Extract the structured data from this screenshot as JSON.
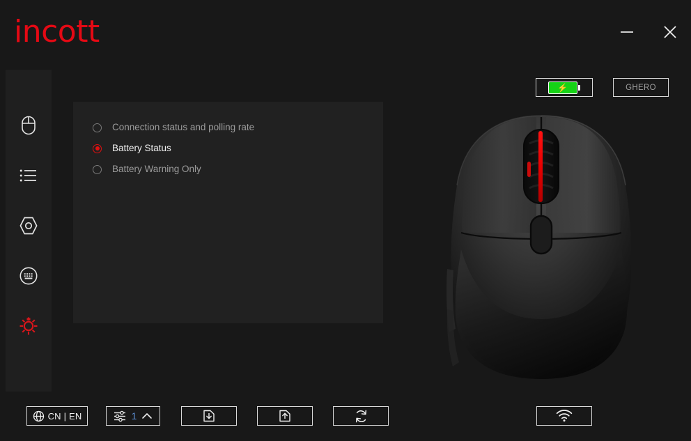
{
  "window": {
    "brand_logo_text": "incott",
    "accent_color": "#e50914",
    "background_color": "#181818",
    "panel_color": "#212121",
    "controls": [
      {
        "name": "minimize",
        "glyph": "minimize-icon"
      },
      {
        "name": "close",
        "glyph": "close-icon"
      }
    ]
  },
  "sidebar": {
    "items": [
      {
        "icon": "mouse-icon",
        "name": "mouse",
        "active": false
      },
      {
        "icon": "list-icon",
        "name": "macro-list",
        "active": false
      },
      {
        "icon": "hex-nut-icon",
        "name": "performance",
        "active": false
      },
      {
        "icon": "keyboard-circle-icon",
        "name": "keyboard",
        "active": false
      },
      {
        "icon": "gear-icon",
        "name": "settings",
        "active": true
      }
    ],
    "active_color": "#d6161b",
    "inactive_color": "#e4e4e4"
  },
  "main": {
    "options": [
      {
        "label": "Connection status and polling rate",
        "selected": false
      },
      {
        "label": "Battery Status",
        "selected": true
      },
      {
        "label": "Battery Warning Only",
        "selected": false
      }
    ]
  },
  "device": {
    "battery": {
      "state": "charging",
      "icon": "battery-charging-icon",
      "fill_color": "#16d316"
    },
    "name": "GHERO",
    "image": "gaming-mouse-top-view"
  },
  "toolbar": {
    "language": {
      "icon": "globe-icon",
      "label": "CN | EN"
    },
    "profile": {
      "icon": "sliders-icon",
      "value": "1",
      "chevron": "chevron-up-icon",
      "value_color": "#5b8fd4"
    },
    "import": {
      "icon": "file-download-icon"
    },
    "export": {
      "icon": "file-upload-icon"
    },
    "reset": {
      "icon": "refresh-icon"
    },
    "wireless": {
      "icon": "wifi-icon"
    }
  }
}
